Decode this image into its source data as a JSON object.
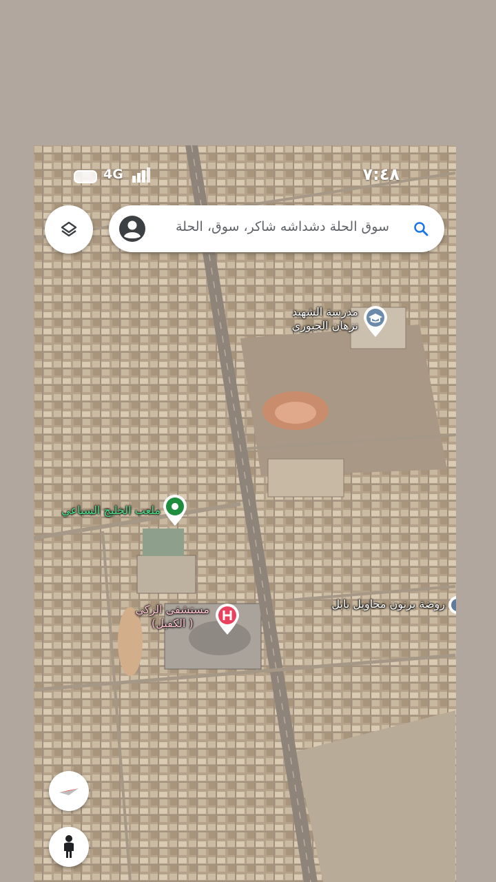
{
  "status_bar": {
    "network": "4G",
    "time": "٧:٤٨"
  },
  "search": {
    "text": "سوق الحلة دشداشه شاكر، سوق، الحلة"
  },
  "icons": {
    "layers": "layers-icon",
    "account": "account-circle-icon",
    "search": "search-icon",
    "compass": "compass-icon",
    "street_view": "pegman-icon"
  },
  "places": [
    {
      "name_line1": "مدرسة الشهيد",
      "name_line2": "نزهان الجبوري",
      "category": "school"
    },
    {
      "name_line1": "ملعب الخليج السباعي",
      "category": "stadium"
    },
    {
      "name_line1": "مستشفى الزكي",
      "name_line2": "( الكفيل)",
      "category": "hospital"
    },
    {
      "name_line1": "روضة برنون محاويل بابل",
      "category": "kindergarten"
    }
  ],
  "colors": {
    "map_tan": "#b9a78f",
    "road": "#8f8479",
    "outer_bg": "#b2a79f",
    "accent_blue": "#1a73e8",
    "hospital_pin": "#e8425f",
    "stadium_pin": "#1e8e3e",
    "school_pin": "#5f7a9a"
  }
}
